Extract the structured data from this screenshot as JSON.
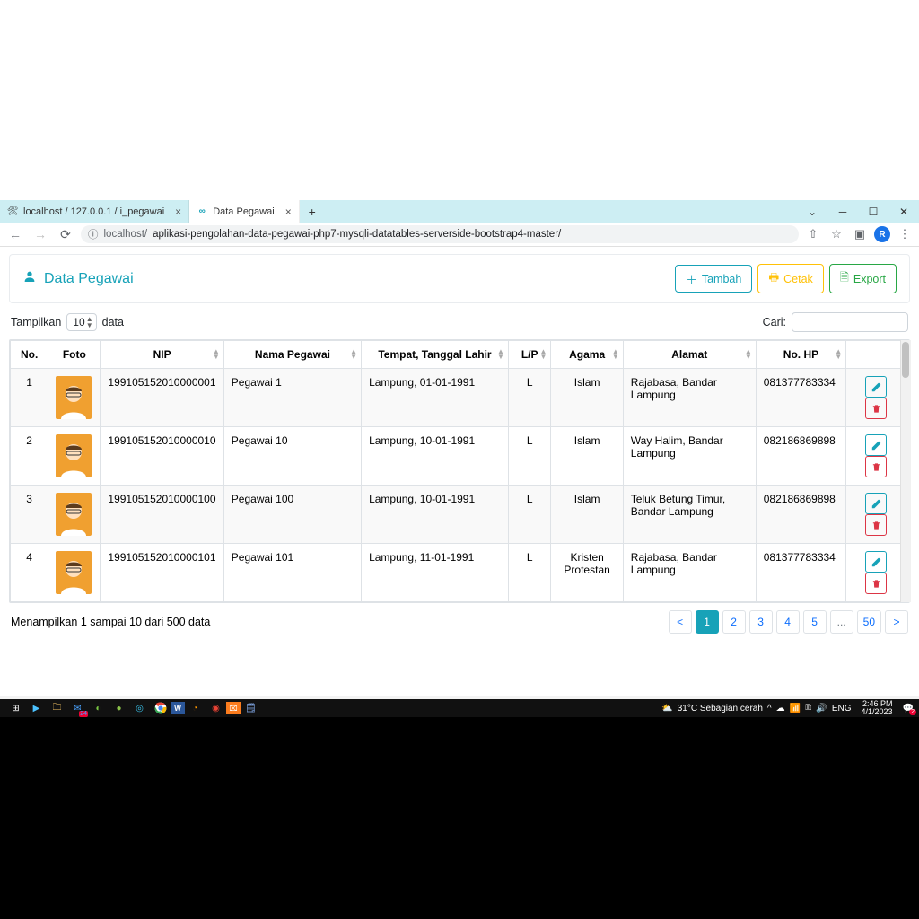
{
  "browser": {
    "tabs": [
      {
        "title": "localhost / 127.0.0.1 / i_pegawai",
        "active": false
      },
      {
        "title": "Data Pegawai",
        "active": true
      }
    ],
    "url_host": "localhost/",
    "url_path": "aplikasi-pengolahan-data-pegawai-php7-mysqli-datatables-serverside-bootstrap4-master/",
    "profile_letter": "R"
  },
  "page": {
    "title": "Data Pegawai",
    "buttons": {
      "add": "Tambah",
      "print": "Cetak",
      "export": "Export"
    },
    "length": {
      "prefix": "Tampilkan",
      "value": "10",
      "suffix": "data"
    },
    "search_label": "Cari:",
    "columns": [
      "No.",
      "Foto",
      "NIP",
      "Nama Pegawai",
      "Tempat, Tanggal Lahir",
      "L/P",
      "Agama",
      "Alamat",
      "No. HP"
    ],
    "rows": [
      {
        "no": "1",
        "nip": "199105152010000001",
        "nama": "Pegawai 1",
        "ttl": "Lampung, 01-01-1991",
        "lp": "L",
        "agama": "Islam",
        "alamat": "Rajabasa, Bandar Lampung",
        "hp": "081377783334"
      },
      {
        "no": "2",
        "nip": "199105152010000010",
        "nama": "Pegawai 10",
        "ttl": "Lampung, 10-01-1991",
        "lp": "L",
        "agama": "Islam",
        "alamat": "Way Halim, Bandar Lampung",
        "hp": "082186869898"
      },
      {
        "no": "3",
        "nip": "199105152010000100",
        "nama": "Pegawai 100",
        "ttl": "Lampung, 10-01-1991",
        "lp": "L",
        "agama": "Islam",
        "alamat": "Teluk Betung Timur, Bandar Lampung",
        "hp": "082186869898"
      },
      {
        "no": "4",
        "nip": "199105152010000101",
        "nama": "Pegawai 101",
        "ttl": "Lampung, 11-01-1991",
        "lp": "L",
        "agama": "Kristen Protestan",
        "alamat": "Rajabasa, Bandar Lampung",
        "hp": "081377783334"
      }
    ],
    "info": "Menampilkan 1 sampai 10 dari 500 data",
    "pages": [
      "<",
      "1",
      "2",
      "3",
      "4",
      "5",
      "...",
      "50",
      ">"
    ],
    "active_page": "1"
  },
  "taskbar": {
    "weather": "31°C  Sebagian cerah",
    "lang": "ENG",
    "time": "2:46 PM",
    "date": "4/1/2023",
    "mail_badge": "24",
    "notif_badge": "2"
  }
}
